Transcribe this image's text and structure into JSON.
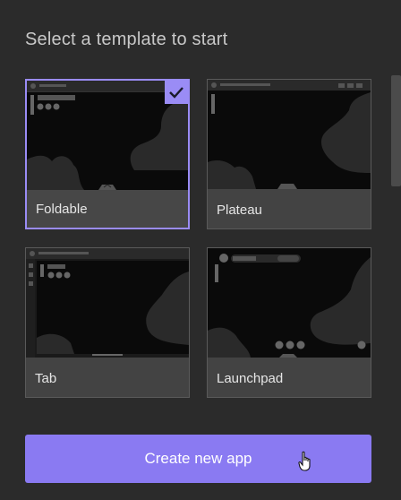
{
  "heading": "Select a template to start",
  "templates": [
    {
      "label": "Foldable",
      "selected": true
    },
    {
      "label": "Plateau",
      "selected": false
    },
    {
      "label": "Tab",
      "selected": false
    },
    {
      "label": "Launchpad",
      "selected": false
    }
  ],
  "create_button": {
    "label": "Create new app"
  },
  "colors": {
    "accent": "#8a7af2",
    "background": "#2b2b2b",
    "card": "#434343",
    "thumbnail": "#0a0a0a"
  },
  "icons": [
    "check-icon",
    "hand-cursor-icon"
  ]
}
